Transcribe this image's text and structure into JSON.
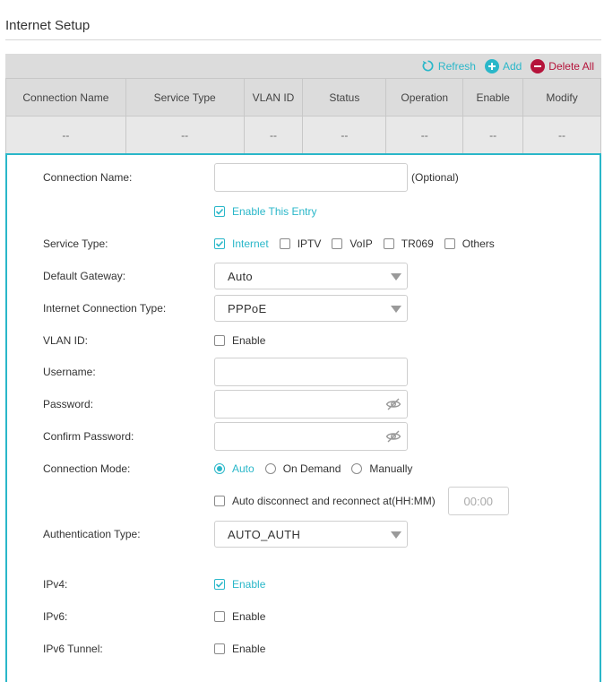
{
  "page": {
    "title": "Internet Setup"
  },
  "toolbar": {
    "refresh": "Refresh",
    "add": "Add",
    "delete_all": "Delete All"
  },
  "colors": {
    "accent": "#2ab7c9",
    "danger": "#b5133a",
    "header_bg": "#dcdcdc"
  },
  "table": {
    "headers": [
      "Connection Name",
      "Service Type",
      "VLAN ID",
      "Status",
      "Operation",
      "Enable",
      "Modify"
    ],
    "rows": [
      [
        "--",
        "--",
        "--",
        "--",
        "--",
        "--",
        "--"
      ]
    ]
  },
  "form": {
    "connection_name": {
      "label": "Connection Name:",
      "value": "",
      "hint": "(Optional)"
    },
    "enable_entry": {
      "label": "Enable This Entry",
      "checked": true
    },
    "service_type": {
      "label": "Service Type:",
      "options": [
        {
          "label": "Internet",
          "checked": true
        },
        {
          "label": "IPTV",
          "checked": false
        },
        {
          "label": "VoIP",
          "checked": false
        },
        {
          "label": "TR069",
          "checked": false
        },
        {
          "label": "Others",
          "checked": false
        }
      ]
    },
    "default_gateway": {
      "label": "Default Gateway:",
      "value": "Auto"
    },
    "internet_connection_type": {
      "label": "Internet Connection Type:",
      "value": "PPPoE"
    },
    "vlan_id": {
      "label": "VLAN ID:",
      "enable_label": "Enable",
      "checked": false
    },
    "username": {
      "label": "Username:",
      "value": ""
    },
    "password": {
      "label": "Password:",
      "value": ""
    },
    "confirm_password": {
      "label": "Confirm Password:",
      "value": ""
    },
    "connection_mode": {
      "label": "Connection Mode:",
      "options": [
        {
          "label": "Auto",
          "checked": true
        },
        {
          "label": "On Demand",
          "checked": false
        },
        {
          "label": "Manually",
          "checked": false
        }
      ]
    },
    "auto_disconnect": {
      "label": "Auto disconnect and reconnect at(HH:MM)",
      "checked": false,
      "time": "00:00"
    },
    "authentication_type": {
      "label": "Authentication Type:",
      "value": "AUTO_AUTH"
    },
    "ipv4": {
      "label": "IPv4:",
      "enable_label": "Enable",
      "checked": true
    },
    "ipv6": {
      "label": "IPv6:",
      "enable_label": "Enable",
      "checked": false
    },
    "ipv6_tunnel": {
      "label": "IPv6 Tunnel:",
      "enable_label": "Enable",
      "checked": false
    }
  }
}
